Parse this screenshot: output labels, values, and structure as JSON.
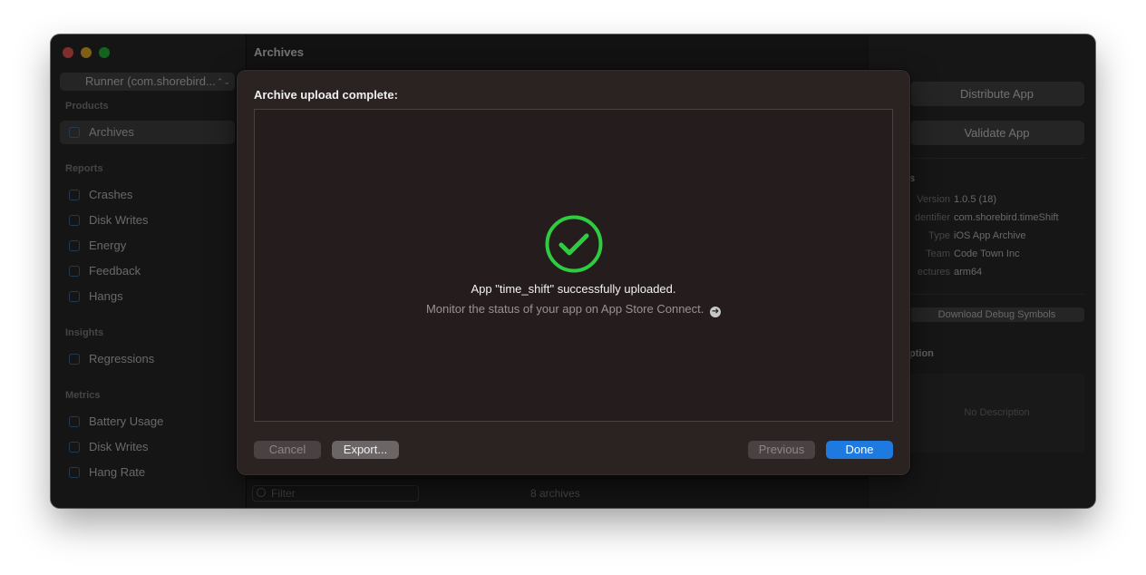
{
  "sidebar": {
    "scheme_label": "Runner (com.shorebird...",
    "sections": {
      "products": "Products",
      "reports": "Reports",
      "insights": "Insights",
      "metrics": "Metrics"
    },
    "items": {
      "archives": "Archives",
      "crashes": "Crashes",
      "disk_writes": "Disk Writes",
      "energy": "Energy",
      "feedback": "Feedback",
      "hangs": "Hangs",
      "regressions": "Regressions",
      "battery_usage": "Battery Usage",
      "metrics_disk_writes": "Disk Writes",
      "hang_rate": "Hang Rate"
    }
  },
  "main": {
    "title": "Archives",
    "filter_placeholder": "Filter",
    "archive_count": "8 archives"
  },
  "inspector": {
    "distribute_label": "Distribute App",
    "validate_label": "Validate App",
    "info_section_partial": "s",
    "info": [
      {
        "key": "Version",
        "value": "1.0.5 (18)"
      },
      {
        "key": "dentifier",
        "value": "com.shorebird.timeShift"
      },
      {
        "key": "Type",
        "value": "iOS App Archive"
      },
      {
        "key": "Team",
        "value": "Code Town Inc"
      },
      {
        "key": "ectures",
        "value": "arm64"
      }
    ],
    "download_symbols_label": "Download Debug Symbols",
    "description_section_partial": "ption",
    "description_placeholder": "No Description"
  },
  "sheet": {
    "title": "Archive upload complete:",
    "success_message": "App \"time_shift\" successfully uploaded.",
    "sub_message": "Monitor the status of your app on App Store Connect.",
    "arrow_glyph": "➜",
    "buttons": {
      "cancel": "Cancel",
      "export": "Export...",
      "previous": "Previous",
      "done": "Done"
    },
    "colors": {
      "success": "#2ecc40",
      "accent": "#1f7ae0"
    }
  }
}
